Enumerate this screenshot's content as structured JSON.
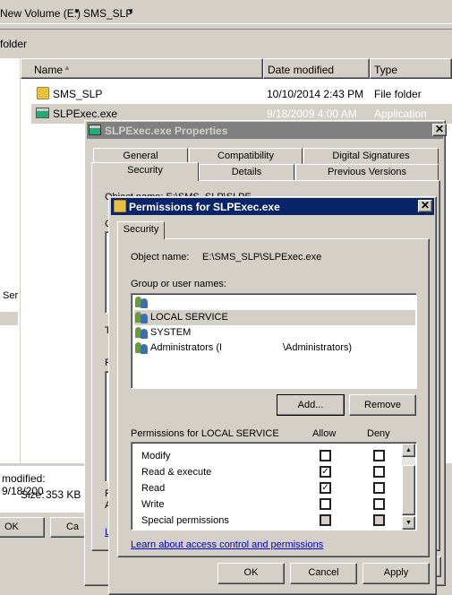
{
  "explorer": {
    "breadcrumb": [
      "New Volume (E:)",
      "SMS_SLP"
    ],
    "toolbar_item": "folder",
    "columns": [
      "Name",
      "Date modified",
      "Type"
    ],
    "files": [
      {
        "name": "SMS_SLP",
        "date": "10/10/2014 2:43 PM",
        "type": "File folder",
        "icon": "folder-icon"
      },
      {
        "name": "SLPExec.exe",
        "date": "9/18/2009 4:00 AM",
        "type": "Application",
        "icon": "application-icon",
        "selected": true
      }
    ],
    "nav_partial": "Ser",
    "details": {
      "modified": "modified: 9/18/200",
      "size_label": "Size:",
      "size": "353 KB"
    },
    "buttons": {
      "ok": "OK",
      "cancel": "Ca"
    }
  },
  "properties": {
    "title": "SLPExec.exe Properties",
    "tabs_row1": [
      "General",
      "Compatibility",
      "Digital Signatures"
    ],
    "tabs_row2": [
      "Security",
      "Details",
      "Previous Versions"
    ],
    "active_tab": "Security",
    "partial_object": "Object name:   E:\\SMS_SLP\\SLPE",
    "partial_labels": [
      "G",
      "T",
      "F",
      "F",
      "A",
      "L"
    ]
  },
  "permissions": {
    "title": "Permissions for SLPExec.exe",
    "tab": "Security",
    "object_label": "Object name:",
    "object_value": "E:\\SMS_SLP\\SLPExec.exe",
    "group_label": "Group or user names:",
    "users": [
      {
        "name": "",
        "selected": false
      },
      {
        "name": "LOCAL SERVICE",
        "selected": true
      },
      {
        "name": "SYSTEM",
        "selected": false
      },
      {
        "name": "Administrators (\\Administrators)",
        "left": "Administrators (I",
        "right": "\\Administrators)",
        "selected": false
      }
    ],
    "add_label": "Add...",
    "remove_label": "Remove",
    "perm_label": "Permissions for LOCAL SERVICE",
    "allow_label": "Allow",
    "deny_label": "Deny",
    "perms": [
      {
        "name": "Modify",
        "allow": false,
        "deny": false
      },
      {
        "name": "Read & execute",
        "allow": true,
        "deny": false
      },
      {
        "name": "Read",
        "allow": true,
        "deny": false
      },
      {
        "name": "Write",
        "allow": false,
        "deny": false
      },
      {
        "name": "Special permissions",
        "allow": false,
        "deny": false,
        "disabled": true
      }
    ],
    "link": "Learn about access control and permissions",
    "ok": "OK",
    "cancel": "Cancel",
    "apply": "Apply"
  },
  "colors": {
    "title_active": "#0a246a",
    "title_inactive": "#808080",
    "face": "#d4d0c8",
    "link": "#0000cc"
  }
}
